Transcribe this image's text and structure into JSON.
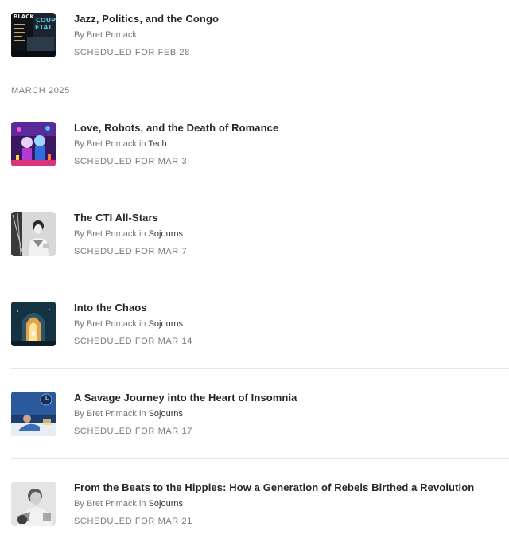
{
  "month_header": "MARCH 2025",
  "posts": [
    {
      "title": "Jazz, Politics, and the Congo",
      "by": "By",
      "author": "Bret Primack",
      "in": "",
      "section": "",
      "scheduled": "SCHEDULED FOR FEB 28",
      "thumb_text": [
        "BLACK",
        "COUP",
        "ÉTAT"
      ]
    },
    {
      "title": "Love, Robots, and the Death of Romance",
      "by": "By",
      "author": "Bret Primack",
      "in": "in",
      "section": "Tech",
      "scheduled": "SCHEDULED FOR MAR 3"
    },
    {
      "title": "The CTI All-Stars",
      "by": "By",
      "author": "Bret Primack",
      "in": "in",
      "section": "Sojourns",
      "scheduled": "SCHEDULED FOR MAR 7"
    },
    {
      "title": "Into the Chaos",
      "by": "By",
      "author": "Bret Primack",
      "in": "in",
      "section": "Sojourns",
      "scheduled": "SCHEDULED FOR MAR 14"
    },
    {
      "title": "A Savage Journey into the Heart of Insomnia",
      "by": "By",
      "author": "Bret Primack",
      "in": "in",
      "section": "Sojourns",
      "scheduled": "SCHEDULED FOR MAR 17"
    },
    {
      "title": "From the Beats to the Hippies: How a Generation of Rebels Birthed a Revolution",
      "by": "By",
      "author": "Bret Primack",
      "in": "in",
      "section": "Sojourns",
      "scheduled": "SCHEDULED FOR MAR 21"
    }
  ]
}
